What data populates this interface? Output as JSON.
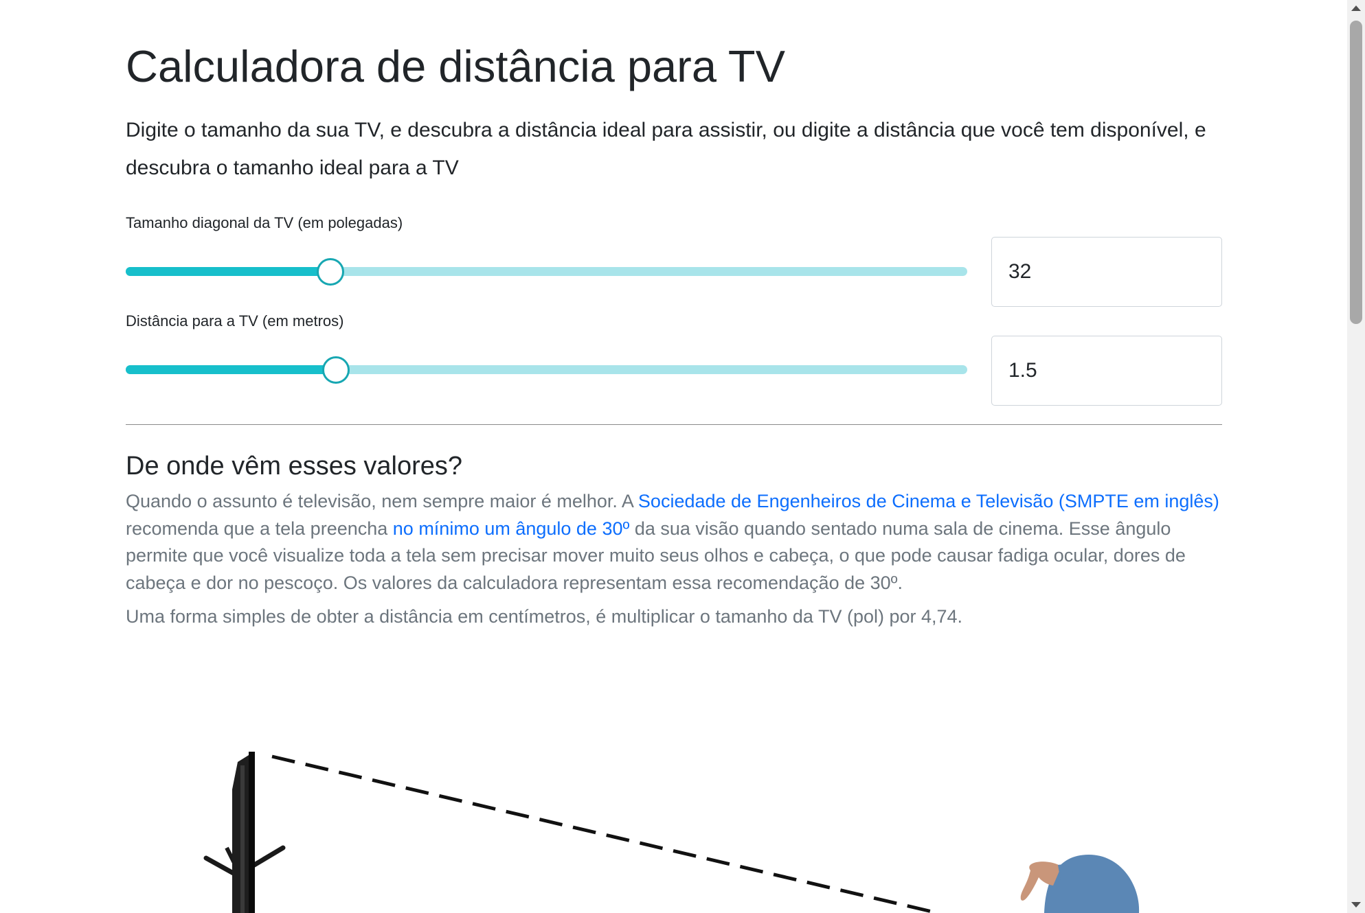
{
  "page": {
    "title": "Calculadora de distância para TV",
    "lead": "Digite o tamanho da sua TV, e descubra a distância ideal para assistir, ou digite a distância que você tem disponível, e descubra o tamanho ideal para a TV"
  },
  "size_control": {
    "label": "Tamanho diagonal da TV (em polegadas)",
    "value": "32",
    "slider_fraction": 0.243
  },
  "distance_control": {
    "label": "Distância para a TV (em metros)",
    "value": "1.5",
    "slider_fraction": 0.25
  },
  "explanation": {
    "heading": "De onde vêm esses valores?",
    "p1_part1": "Quando o assunto é televisão, nem sempre maior é melhor. A ",
    "p1_link1": "Sociedade de Engenheiros de Cinema e Televisão (SMPTE em inglês)",
    "p1_part2": " recomenda que a tela preencha ",
    "p1_link2": "no mínimo um ângulo de 30º",
    "p1_part3": " da sua visão quando sentado numa sala de cinema. Esse ângulo permite que você visualize toda a tela sem precisar mover muito seus olhos e cabeça, o que pode causar fadiga ocular, dores de cabeça e dor no pescoço. Os valores da calculadora representam essa recomendação de 30º.",
    "p2": "Uma forma simples de obter a distância em centímetros, é multiplicar o tamanho da TV (pol) por 4,74."
  },
  "colors": {
    "slider_fill": "#17bfcb",
    "slider_track": "#a8e4ea",
    "slider_thumb_border": "#17a7b2",
    "link": "#0d6efd",
    "muted_text": "#6c757d",
    "person_shirt": "#5b87b5",
    "person_skin": "#c9967a"
  },
  "illustration": {
    "icons": [
      "tv-icon",
      "viewer-icon",
      "sightline"
    ]
  }
}
